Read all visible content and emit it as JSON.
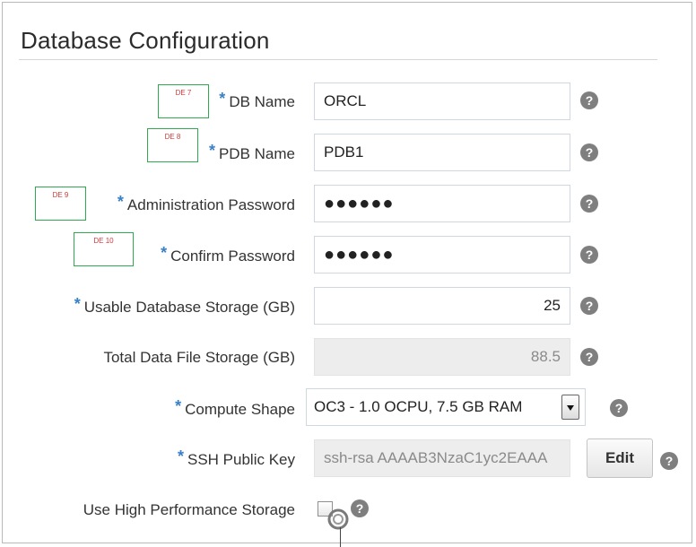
{
  "title": "Database Configuration",
  "help_glyph": "?",
  "fields": [
    {
      "label": "DB Name",
      "value": "ORCL",
      "required": true,
      "marker": "DE 7"
    },
    {
      "label": "PDB Name",
      "value": "PDB1",
      "required": true,
      "marker": "DE 8"
    },
    {
      "label": "Administration Password",
      "value": "●●●●●●",
      "required": true,
      "marker": "DE 9"
    },
    {
      "label": "Confirm Password",
      "value": "●●●●●●",
      "required": true,
      "marker": "DE 10"
    },
    {
      "label": "Usable Database Storage (GB)",
      "value": "25",
      "required": true
    },
    {
      "label": "Total Data File Storage (GB)",
      "value": "88.5",
      "required": false
    },
    {
      "label": "Compute Shape",
      "value": "OC3 - 1.0 OCPU, 7.5 GB RAM",
      "required": true
    },
    {
      "label": "SSH Public Key",
      "value": "ssh-rsa AAAAB3NzaC1yc2EAAA",
      "required": true
    },
    {
      "label": "Use High Performance Storage",
      "checked": false,
      "required": false
    }
  ],
  "required_marker": "*",
  "edit_button": "Edit"
}
